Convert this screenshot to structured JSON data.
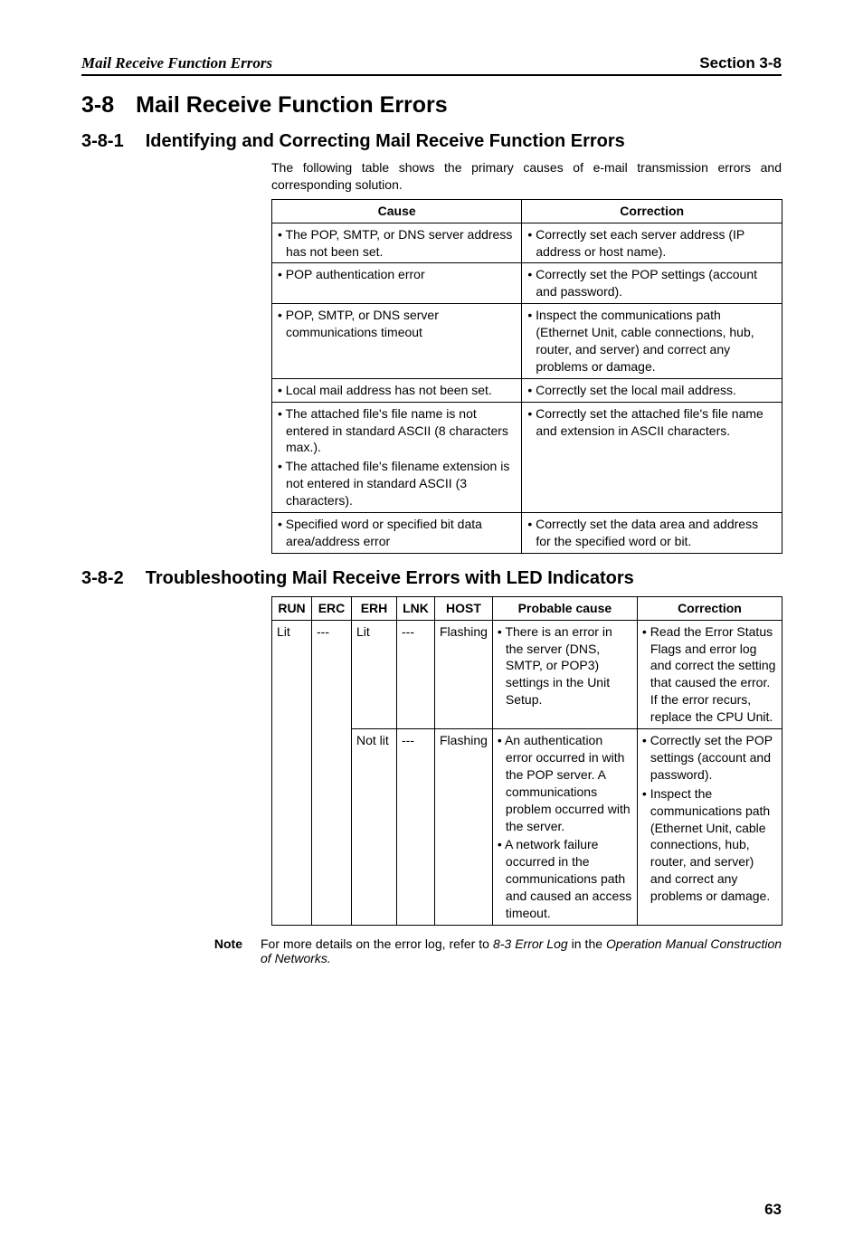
{
  "header": {
    "left": "Mail Receive Function Errors",
    "right": "Section 3-8"
  },
  "h1": {
    "num": "3-8",
    "title": "Mail Receive Function Errors"
  },
  "h2a": {
    "num": "3-8-1",
    "title": "Identifying and Correcting Mail Receive Function Errors"
  },
  "intro1": "The following table shows the primary causes of e-mail transmission errors and corresponding solution.",
  "t1": {
    "h_cause": "Cause",
    "h_corr": "Correction",
    "rows": [
      {
        "cause": "• The POP, SMTP, or DNS server address has not been set.",
        "corr": "• Correctly set each server address (IP address or host name)."
      },
      {
        "cause": "• POP authentication error",
        "corr": "• Correctly set the POP settings (account and password)."
      },
      {
        "cause": "• POP, SMTP, or DNS server communications timeout",
        "corr": "• Inspect the communications path (Ethernet Unit, cable connections, hub, router, and server) and correct any problems or damage."
      },
      {
        "cause": "• Local mail address has not been set.",
        "corr": "• Correctly set the local mail address."
      },
      {
        "cause": "• The attached file's file name is not entered in standard ASCII (8 characters max.).",
        "cause2": "• The attached file's filename extension is not entered in standard ASCII (3 characters).",
        "corr": "• Correctly set the attached file's file name and extension in ASCII characters."
      },
      {
        "cause": "• Specified word or specified bit data area/address error",
        "corr": "• Correctly set the data area and address for the specified word or bit."
      }
    ]
  },
  "h2b": {
    "num": "3-8-2",
    "title": "Troubleshooting Mail Receive Errors with LED Indicators"
  },
  "t2": {
    "h_run": "RUN",
    "h_erc": "ERC",
    "h_erh": "ERH",
    "h_lnk": "LNK",
    "h_host": "HOST",
    "h_cause": "Probable cause",
    "h_corr": "Correction",
    "rows": [
      {
        "run": "Lit",
        "erc": "---",
        "erh": "Lit",
        "lnk": "---",
        "host": "Flashing",
        "cause": "• There is an error in the server (DNS, SMTP, or POP3) settings in the Unit Setup.",
        "corr": "• Read the Error Status Flags and error log and correct the setting that caused the error. If the error recurs, replace the CPU Unit."
      },
      {
        "erh": "Not lit",
        "lnk": "---",
        "host": "Flashing",
        "cause": "• An authentication error occurred in with the POP server. A communications problem occurred with the server.",
        "cause2": "• A network failure occurred in the communications path and caused an access timeout.",
        "corr": "• Correctly set the POP settings (account and password).",
        "corr2": "• Inspect the communications path (Ethernet Unit, cable connections, hub, router, and server) and correct any problems or damage."
      }
    ]
  },
  "note": {
    "label": "Note",
    "body_pre": "For more details on the error log, refer to ",
    "body_ital1": "8-3 Error Log",
    "body_mid": " in the ",
    "body_ital2": "Operation Manual Construction of Networks.",
    "body_post": ""
  },
  "page_num": "63"
}
